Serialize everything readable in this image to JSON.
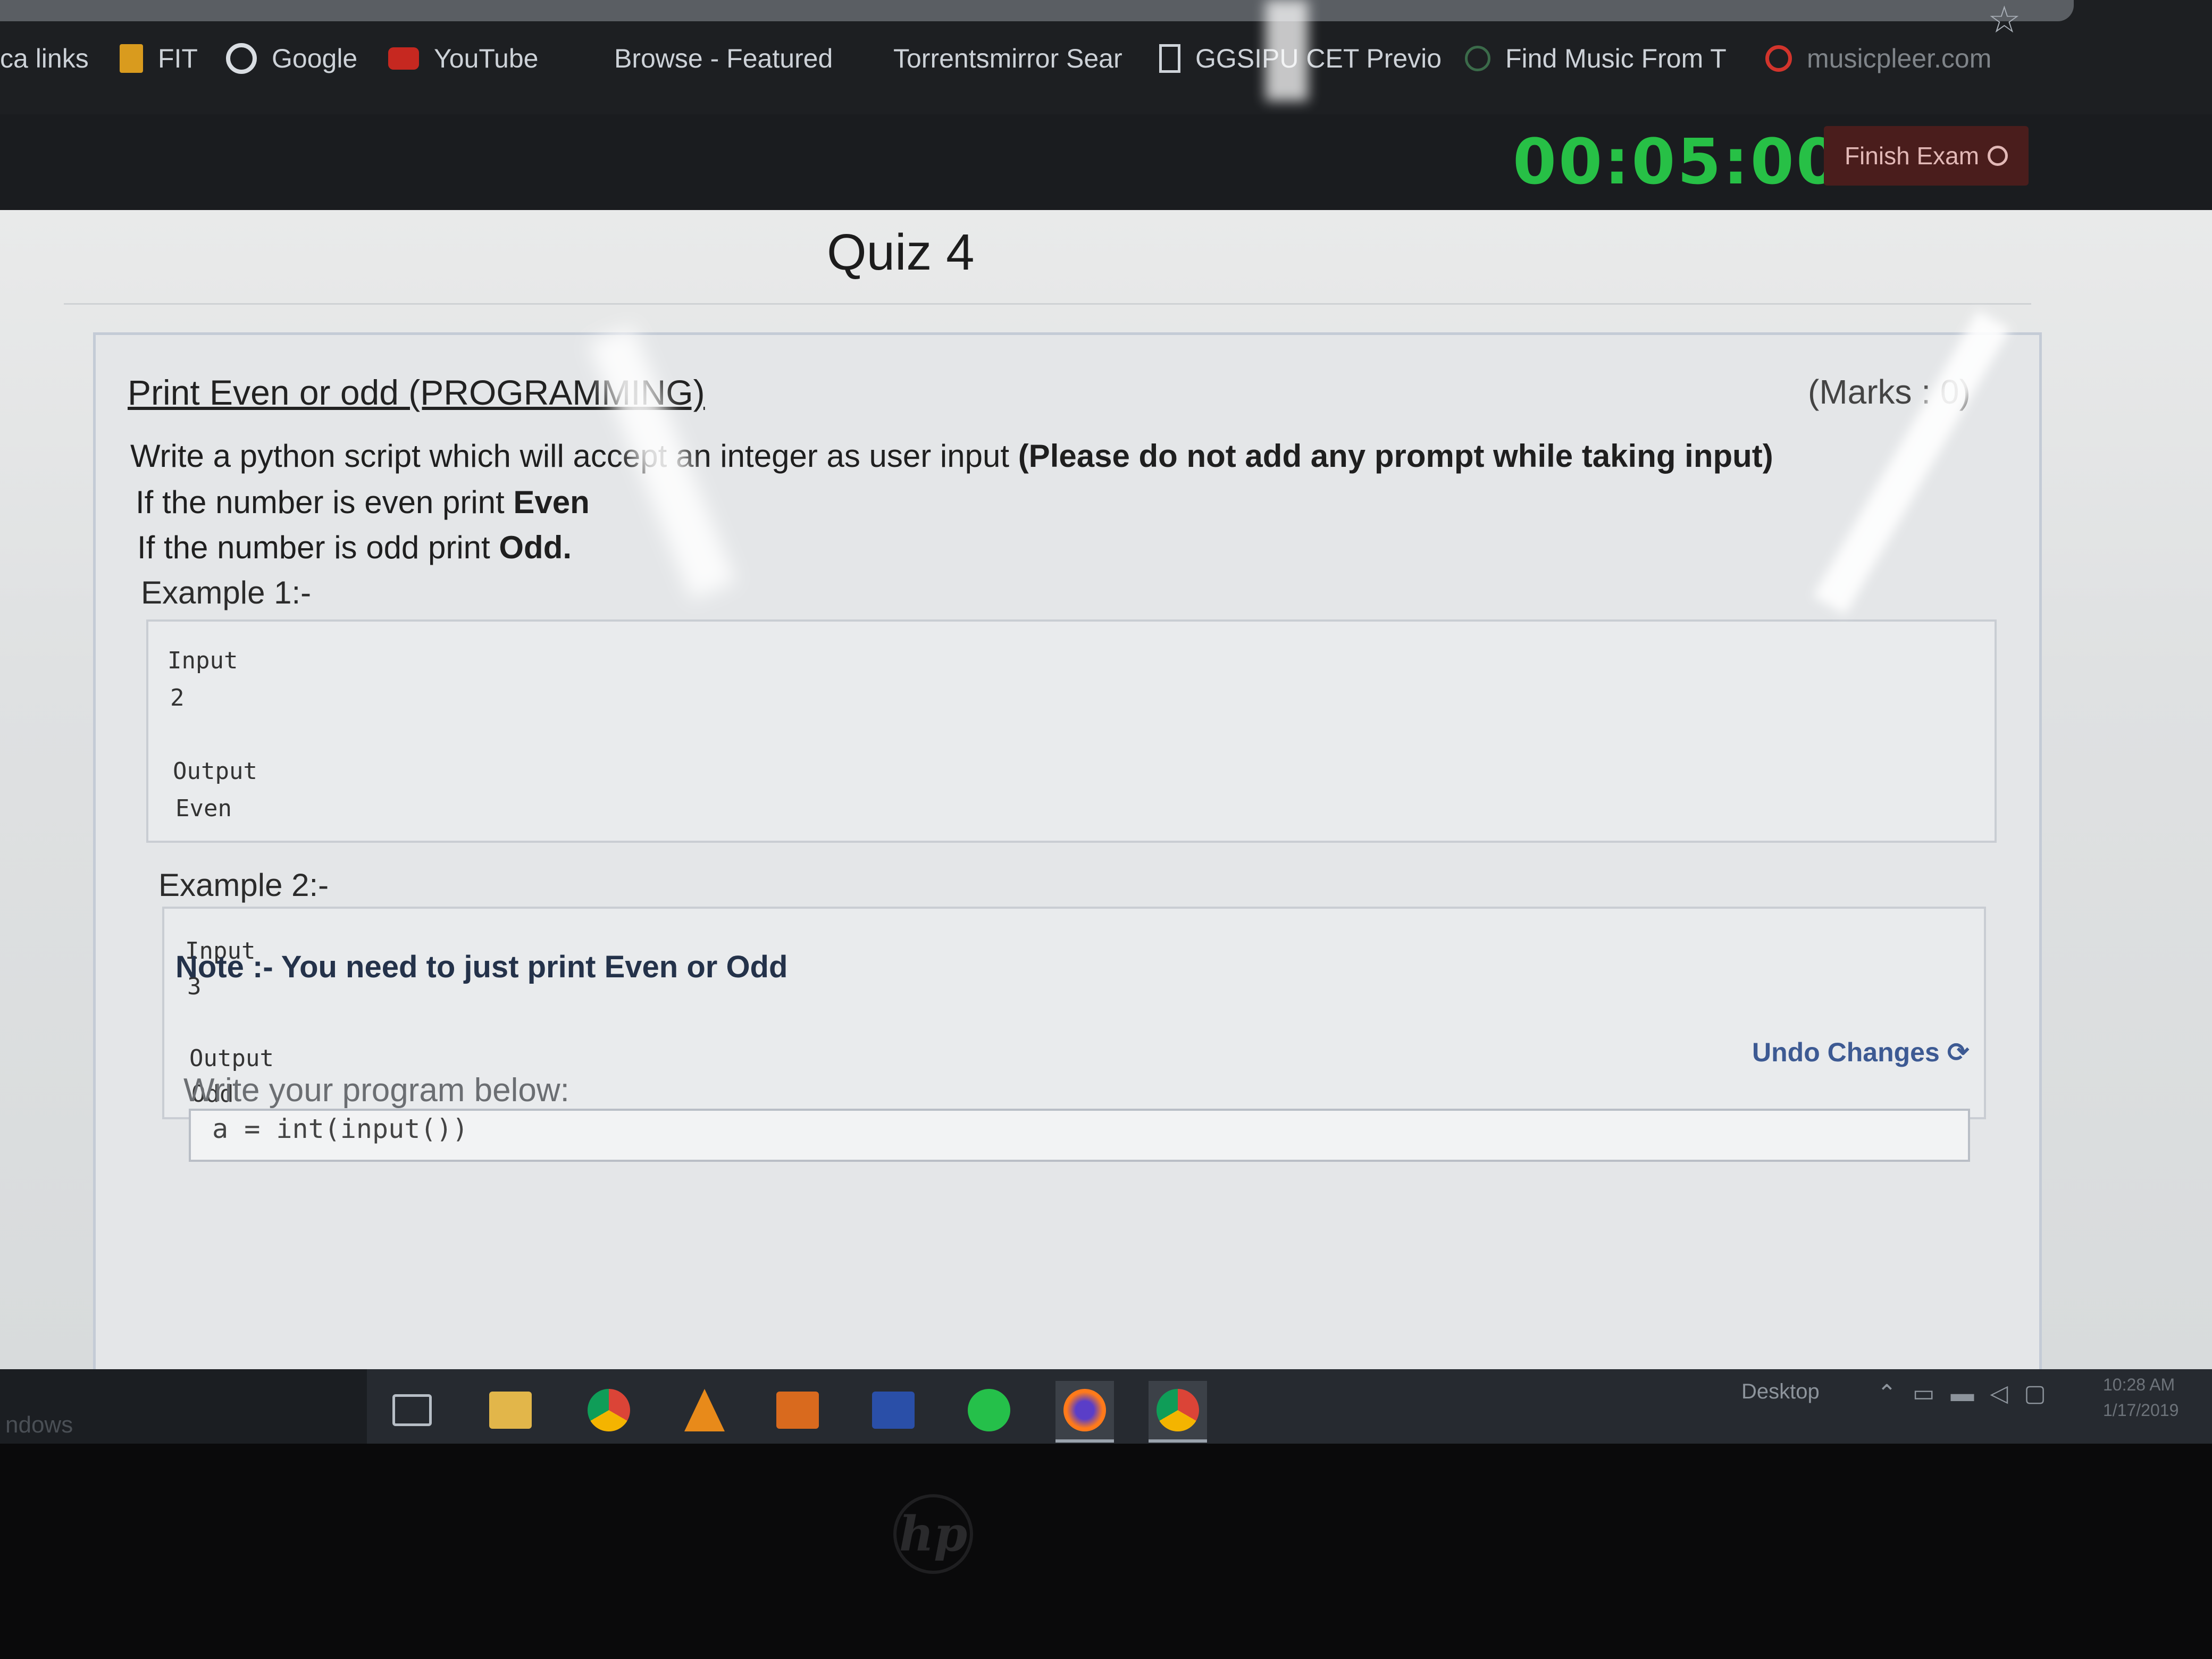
{
  "bookmarks": {
    "items": [
      {
        "label": "ca links",
        "icon": "none"
      },
      {
        "label": "FIT",
        "icon": "folder-icon"
      },
      {
        "label": "Google",
        "icon": "google-icon"
      },
      {
        "label": "YouTube",
        "icon": "youtube-icon"
      },
      {
        "label": "Browse - Featured",
        "icon": "none"
      },
      {
        "label": "Torrentsmirror Sear",
        "icon": "none"
      },
      {
        "label": "GGSIPU CET Previo",
        "icon": "page-icon"
      },
      {
        "label": "Find Music From T",
        "icon": "loading-icon"
      },
      {
        "label": "musicpleer.com",
        "icon": "musicpleer-icon"
      }
    ]
  },
  "header": {
    "timer": "00:05:00",
    "finish_label": "Finish Exam"
  },
  "quiz": {
    "title": "Quiz 4",
    "question_title": "Print Even or odd (PROGRAMMING)",
    "marks": "(Marks : 0)",
    "desc1_a": "Write a python script which will accept an integer as user input ",
    "desc1_b": "(Please do not add any prompt while taking input)",
    "desc2_a": "If the number is even print ",
    "desc2_b": "Even",
    "desc3_a": "If the number is odd print ",
    "desc3_b": "Odd.",
    "examples": [
      {
        "label": "Example 1:-",
        "input_label": "Input",
        "input": "2",
        "output_label": "Output",
        "output": "Even"
      },
      {
        "label": "Example 2:-",
        "input_label": "Input",
        "input": "3",
        "output_label": "Output",
        "output": "Odd"
      }
    ],
    "note": "Note :- You need to just print Even or Odd",
    "undo_label": "Undo Changes",
    "write_label": "Write your program below:",
    "editor_code": "a = int(input())"
  },
  "taskbar": {
    "search_text": "ndows",
    "desktop_label": "Desktop",
    "clock_time": "10:28 AM",
    "clock_date": "1/17/2019"
  },
  "colors": {
    "timer": "#27c046",
    "finish_bg": "#4a1d1c",
    "undo": "#3d5a93",
    "note": "#24324a"
  }
}
